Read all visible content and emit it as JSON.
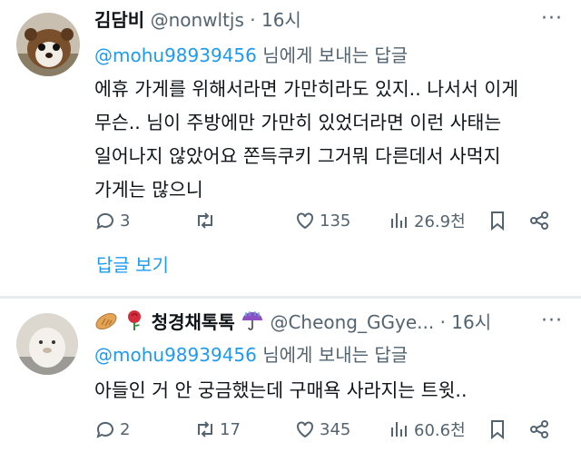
{
  "tweet1": {
    "display_name": "김담비",
    "handle": "@nonwltjs",
    "separator": "·",
    "time": "16시",
    "more_label": "···",
    "reply_mention": "@mohu98939456",
    "reply_suffix": " 님에게 보내는 답글",
    "text_lines": [
      "에휴 가게를 위해서라면 가만히라도 있지.. 나서서 이게",
      "무슨.. 님이 주방에만 가만히 있었더라면 이런 사태는",
      "일어나지 않았어요 쫀득쿠키 그거뭐 다른데서 사먹지",
      "가게는 많으니"
    ],
    "replies": "3",
    "retweets": "",
    "likes": "135",
    "views": "26.9천",
    "show_replies": "답글 보기"
  },
  "tweet2": {
    "display_name": "청경채톡톡",
    "handle": "@Cheong_GGye...",
    "separator": "·",
    "time": "16시",
    "more_label": "···",
    "reply_mention": "@mohu98939456",
    "reply_suffix": " 님에게 보내는 답글",
    "text_lines": [
      "아들인 거 안 궁금했는데 구매욕 사라지는 트윗.."
    ],
    "replies": "2",
    "retweets": "17",
    "likes": "345",
    "views": "60.6천"
  },
  "colors": {
    "accent": "#1d9bf0",
    "secondary_text": "#536471",
    "primary_text": "#0f1419",
    "divider": "#e7ecef"
  },
  "icons": [
    "reply-icon",
    "retweet-icon",
    "like-icon",
    "views-icon",
    "bookmark-icon",
    "share-icon",
    "more-icon",
    "bread-emoji",
    "rose-emoji",
    "umbrella-emoji"
  ]
}
